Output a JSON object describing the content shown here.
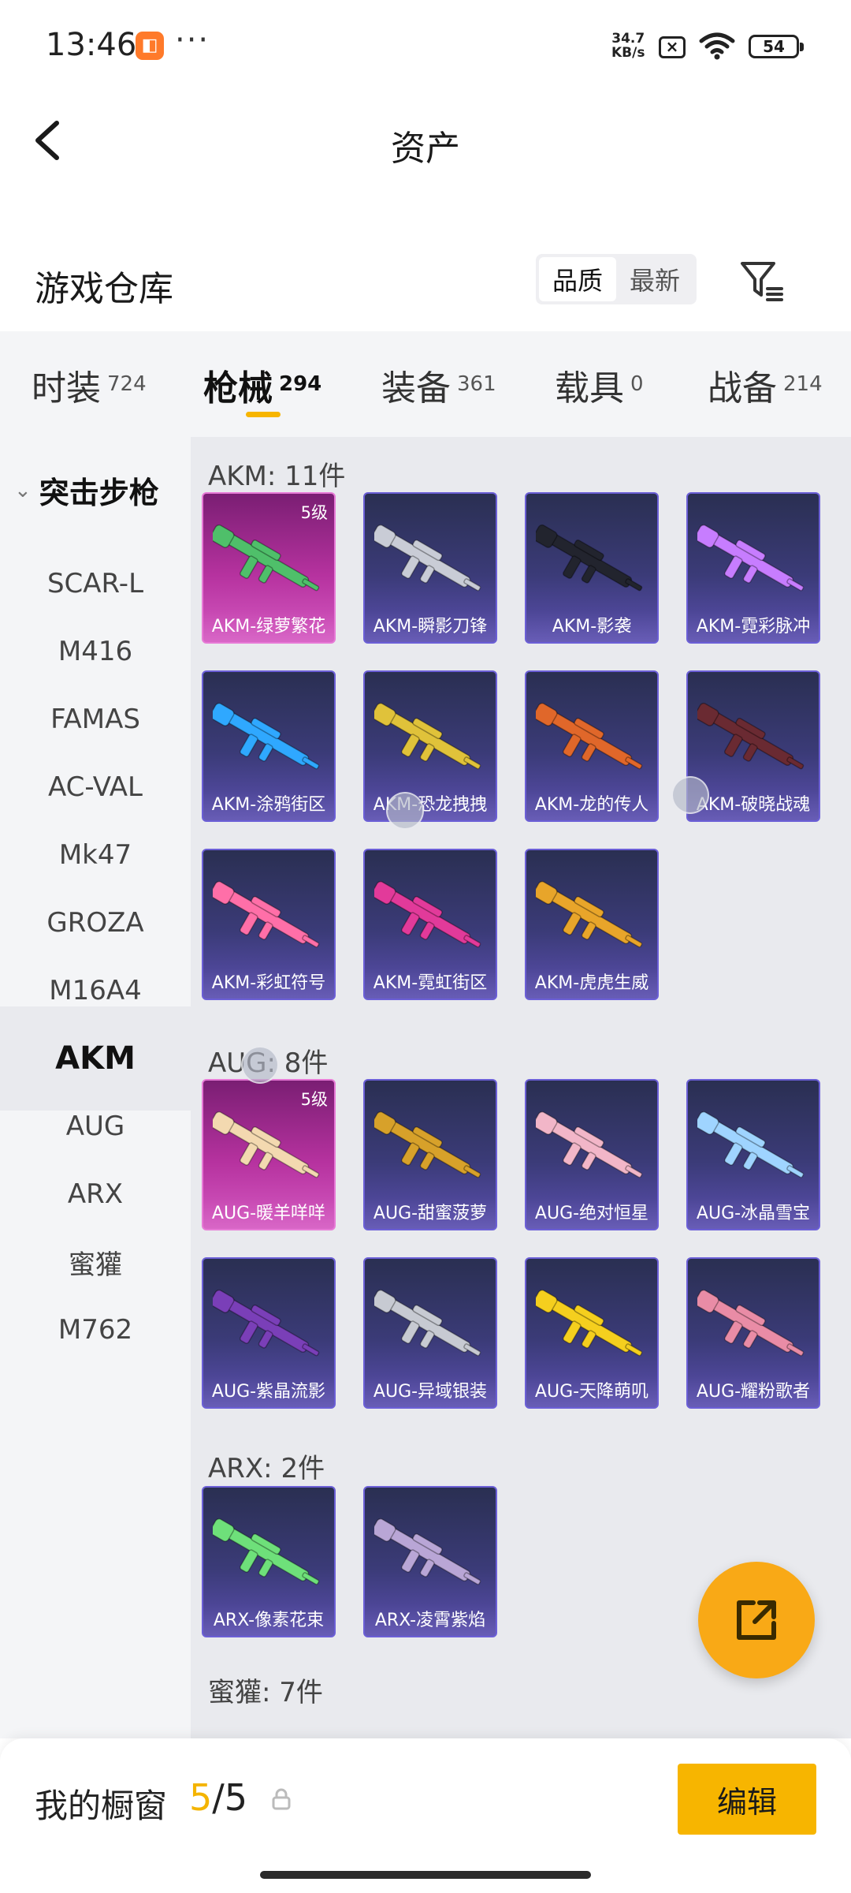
{
  "status_bar": {
    "time": "13:46",
    "net_speed": "34.7",
    "net_unit": "KB/s",
    "battery": "54"
  },
  "header": {
    "title": "资产"
  },
  "warehouse": {
    "title": "游戏仓库",
    "sort_options": [
      "品质",
      "最新"
    ],
    "active_sort": "品质"
  },
  "categories": [
    {
      "name": "时装",
      "count": "724"
    },
    {
      "name": "枪械",
      "count": "294",
      "active": true
    },
    {
      "name": "装备",
      "count": "361"
    },
    {
      "name": "载具",
      "count": "0"
    },
    {
      "name": "战备",
      "count": "214"
    }
  ],
  "sidebar": {
    "group": "突击步枪",
    "items": [
      "SCAR-L",
      "M416",
      "FAMAS",
      "AC-VAL",
      "Mk47",
      "GROZA",
      "M16A4",
      "AKM",
      "AUG",
      "ARX",
      "蜜獾",
      "M762"
    ],
    "active": "AKM"
  },
  "sections": [
    {
      "heading": "AKM: 11件",
      "items": [
        {
          "name": "AKM-绿萝繁花",
          "level": "5级",
          "tier": "gold",
          "color": "#4fbf6a"
        },
        {
          "name": "AKM-瞬影刀锋",
          "tier": "purple",
          "color": "#c9ccd6"
        },
        {
          "name": "AKM-影袭",
          "tier": "purple",
          "color": "#22242e"
        },
        {
          "name": "AKM-霓彩脉冲",
          "tier": "purple",
          "color": "#c77dff"
        },
        {
          "name": "AKM-涂鸦街区",
          "tier": "purple",
          "color": "#2fa8ff"
        },
        {
          "name": "AKM-恐龙拽拽",
          "tier": "purple",
          "color": "#e0c23a"
        },
        {
          "name": "AKM-龙的传人",
          "tier": "purple",
          "color": "#e0672a"
        },
        {
          "name": "AKM-破晓战魂",
          "tier": "purple",
          "color": "#6a2a32"
        },
        {
          "name": "AKM-彩虹符号",
          "tier": "purple",
          "color": "#ff6fa8"
        },
        {
          "name": "AKM-霓虹街区",
          "tier": "purple",
          "color": "#e23a9a"
        },
        {
          "name": "AKM-虎虎生威",
          "tier": "purple",
          "color": "#e8a52a"
        }
      ]
    },
    {
      "heading": "AUG: 8件",
      "items": [
        {
          "name": "AUG-暖羊咩咩",
          "level": "5级",
          "tier": "gold",
          "color": "#f3d9b0"
        },
        {
          "name": "AUG-甜蜜菠萝",
          "tier": "purple",
          "color": "#d7a12a"
        },
        {
          "name": "AUG-绝对恒星",
          "tier": "purple",
          "color": "#f2b6c8"
        },
        {
          "name": "AUG-冰晶雪宝",
          "tier": "purple",
          "color": "#9fd4ff"
        },
        {
          "name": "AUG-紫晶流影",
          "tier": "purple",
          "color": "#7a3fb8"
        },
        {
          "name": "AUG-异域银装",
          "tier": "purple",
          "color": "#c7cad2"
        },
        {
          "name": "AUG-天降萌叽",
          "tier": "purple",
          "color": "#f5cf1e"
        },
        {
          "name": "AUG-耀粉歌者",
          "tier": "purple",
          "color": "#e98ca6"
        }
      ]
    },
    {
      "heading": "ARX: 2件",
      "items": [
        {
          "name": "ARX-像素花束",
          "tier": "purple",
          "color": "#6ee07a"
        },
        {
          "name": "ARX-凌霄紫焰",
          "tier": "purple",
          "color": "#b9a6d6"
        }
      ]
    },
    {
      "heading": "蜜獾: 7件",
      "items": []
    }
  ],
  "bottom": {
    "showcase_label": "我的橱窗",
    "used": "5",
    "separator": "/",
    "total": "5",
    "edit_label": "编辑"
  },
  "colors": {
    "accent": "#f7b500",
    "fab": "#f9a916"
  }
}
